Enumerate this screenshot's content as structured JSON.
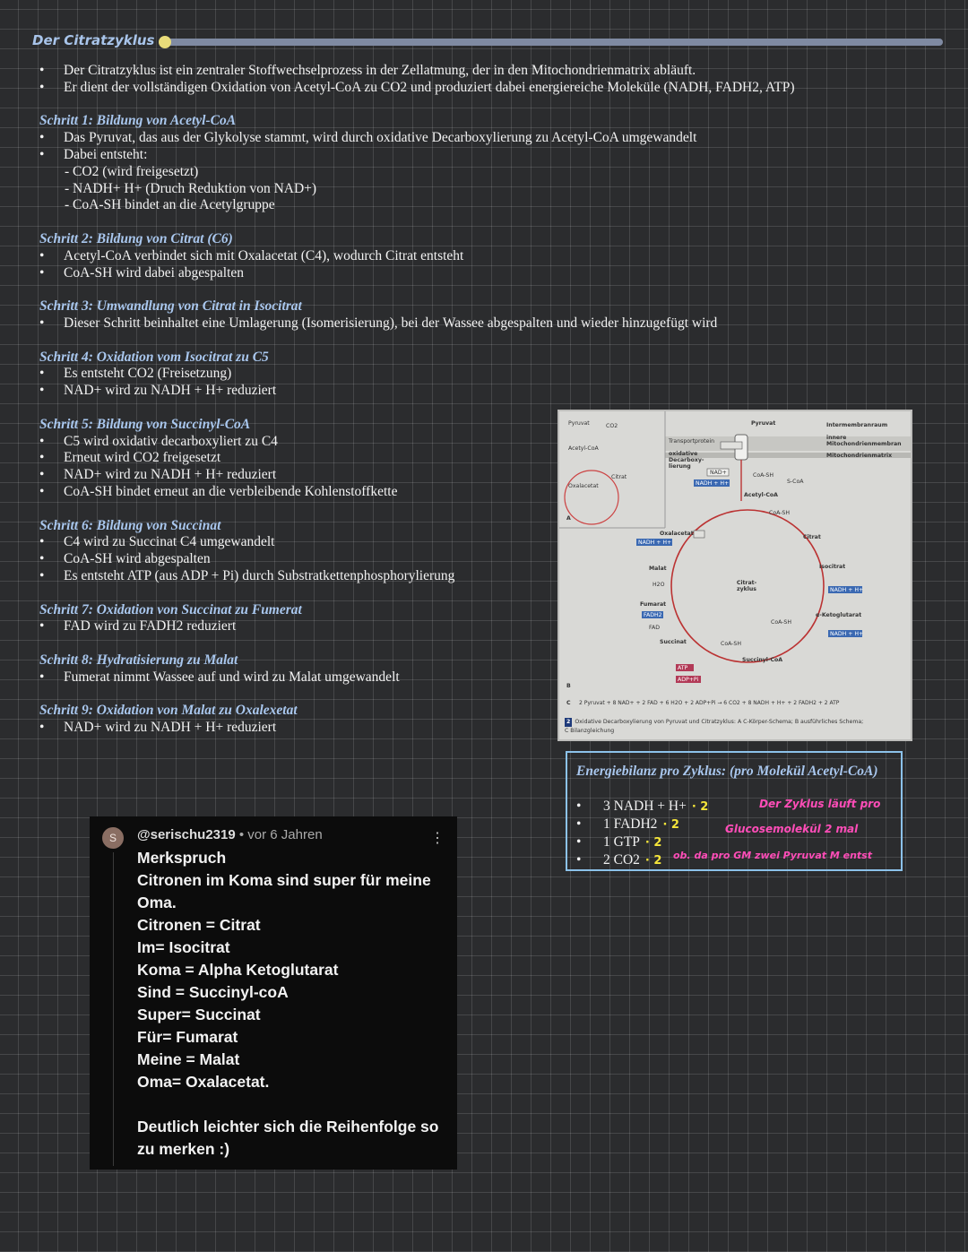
{
  "title": "Der Citratzyklus",
  "intro": [
    "Der Citratzyklus ist ein zentraler Stoffwechselprozess in der Zellatmung, der in den Mitochondrienmatrix abläuft.",
    "Er dient der vollständigen Oxidation von Acetyl-CoA zu CO2 und produziert dabei energiereiche Moleküle (NADH, FADH2, ATP)"
  ],
  "steps": [
    {
      "heading": "Schritt 1: Bildung von Acetyl-CoA",
      "bullets": [
        "Das Pyruvat, das aus der Glykolyse stammt, wird durch oxidative Decarboxylierung zu Acetyl-CoA umgewandelt",
        "Dabei entsteht:"
      ],
      "sub": [
        "- CO2 (wird freigesetzt)",
        "- NADH+ H+ (Druch Reduktion von NAD+)",
        "- CoA-SH bindet an die Acetylgruppe"
      ]
    },
    {
      "heading": "Schritt 2: Bildung von Citrat (C6)",
      "bullets": [
        "Acetyl-CoA verbindet sich mit Oxalacetat (C4), wodurch Citrat entsteht",
        "CoA-SH wird dabei abgespalten"
      ]
    },
    {
      "heading": "Schritt 3: Umwandlung von Citrat in Isocitrat",
      "bullets": [
        "Dieser Schritt beinhaltet eine Umlagerung (Isomerisierung), bei der Wassee abgespalten und wieder hinzugefügt wird"
      ]
    },
    {
      "heading": "Schritt 4: Oxidation vom Isocitrat zu C5",
      "bullets": [
        "Es entsteht CO2 (Freisetzung)",
        "NAD+ wird zu NADH + H+ reduziert"
      ]
    },
    {
      "heading": "Schritt 5: Bildung von Succinyl-CoA",
      "bullets": [
        "C5 wird oxidativ decarboxyliert zu C4",
        "Erneut wird CO2 freigesetzt",
        "NAD+ wird zu NADH + H+ reduziert",
        "CoA-SH bindet erneut an die verbleibende Kohlenstoffkette"
      ]
    },
    {
      "heading": "Schritt 6: Bildung von Succinat",
      "bullets": [
        "C4 wird zu Succinat C4 umgewandelt",
        "CoA-SH wird abgespalten",
        "Es entsteht ATP (aus ADP + Pi) durch Substratkettenphosphorylierung"
      ]
    },
    {
      "heading": "Schritt 7: Oxidation von Succinat zu Fumerat",
      "bullets": [
        "FAD wird zu FADH2 reduziert"
      ]
    },
    {
      "heading": "Schritt 8: Hydratisierung zu Malat",
      "bullets": [
        "Fumerat nimmt Wassee auf und wird zu Malat umgewandelt"
      ]
    },
    {
      "heading": "Schritt 9: Oxidation von Malat zu Oxalexetat",
      "bullets": [
        "NAD+ wird zu NADH + H+ reduziert"
      ]
    }
  ],
  "figure": {
    "labels": {
      "pyruvat": "Pyruvat",
      "co2": "CO2",
      "acetyl_coa": "Acetyl-CoA",
      "oxalacetat": "Oxalacetat",
      "citrat": "Citrat",
      "transportprotein": "Transportprotein",
      "intermembranraum": "Intermembranraum",
      "innere_membran": "innere Mitochondrienmembran",
      "matrix": "Mitochondrienmatrix",
      "oxidative": "oxidative Decarboxy-lierung",
      "nad": "NAD+",
      "nadh": "NADH + H+",
      "coa_sh": "CoA-SH",
      "s_coa": "S-CoA",
      "h2o": "H2O",
      "isocitrat": "Isocitrat",
      "ketoglutarat": "α-Ketoglutarat",
      "succinyl_coa": "Succinyl-CoA",
      "succinat": "Succinat",
      "fumarat": "Fumarat",
      "malat": "Malat",
      "fadh2": "FADH2",
      "fad": "FAD",
      "atp": "ATP",
      "adp": "ADP+Pi",
      "cycle": "Citrat-zyklus",
      "panel_a": "A",
      "panel_b": "B",
      "panel_c": "C"
    },
    "equation": "2 Pyruvat + 8 NAD+ + 2 FAD + 6 H2O + 2 ADP+Pi → 6 CO2 + 8 NADH + H+ + 2 FADH2 + 2 ATP",
    "caption_num": "2",
    "caption": "Oxidative Decarboxylierung von Pyruvat und Citratzyklus: A C-Körper-Schema; B ausführliches Schema;",
    "caption2": "C Bilanzgleichung"
  },
  "energy": {
    "title": "Energiebilanz pro Zyklus: (pro Molekül Acetyl-CoA)",
    "items": [
      {
        "text": "3 NADH + H+",
        "mult": "· 2"
      },
      {
        "text": "1 FADH2",
        "mult": "· 2"
      },
      {
        "text": "1 GTP",
        "mult": "· 2"
      },
      {
        "text": "2 CO2",
        "mult": "· 2"
      }
    ],
    "note1": "Der Zyklus läuft pro",
    "note2": "Glucosemolekül  2 mal",
    "note3": "ob. da pro GM zwei Pyruvat M entst"
  },
  "comment": {
    "avatar": "S",
    "author": "@serischu2319",
    "time": " • vor 6 Jahren",
    "menu": "⋮",
    "lines": [
      "Merkspruch",
      "Citronen im Koma sind super für meine Oma.",
      "Citronen = Citrat",
      "Im= Isocitrat",
      "Koma = Alpha Ketoglutarat",
      "Sind = Succinyl-coA",
      "Super= Succinat",
      "Für= Fumarat",
      "Meine = Malat",
      "Oma= Oxalacetat.",
      "",
      "Deutlich leichter sich die Reihenfolge so zu merken :)"
    ]
  },
  "colors": {
    "heading": "#a9c7ee",
    "highlight_yellow": "#f5e53a",
    "highlight_pink": "#ff4db8",
    "box_border": "#8cc2ea"
  }
}
